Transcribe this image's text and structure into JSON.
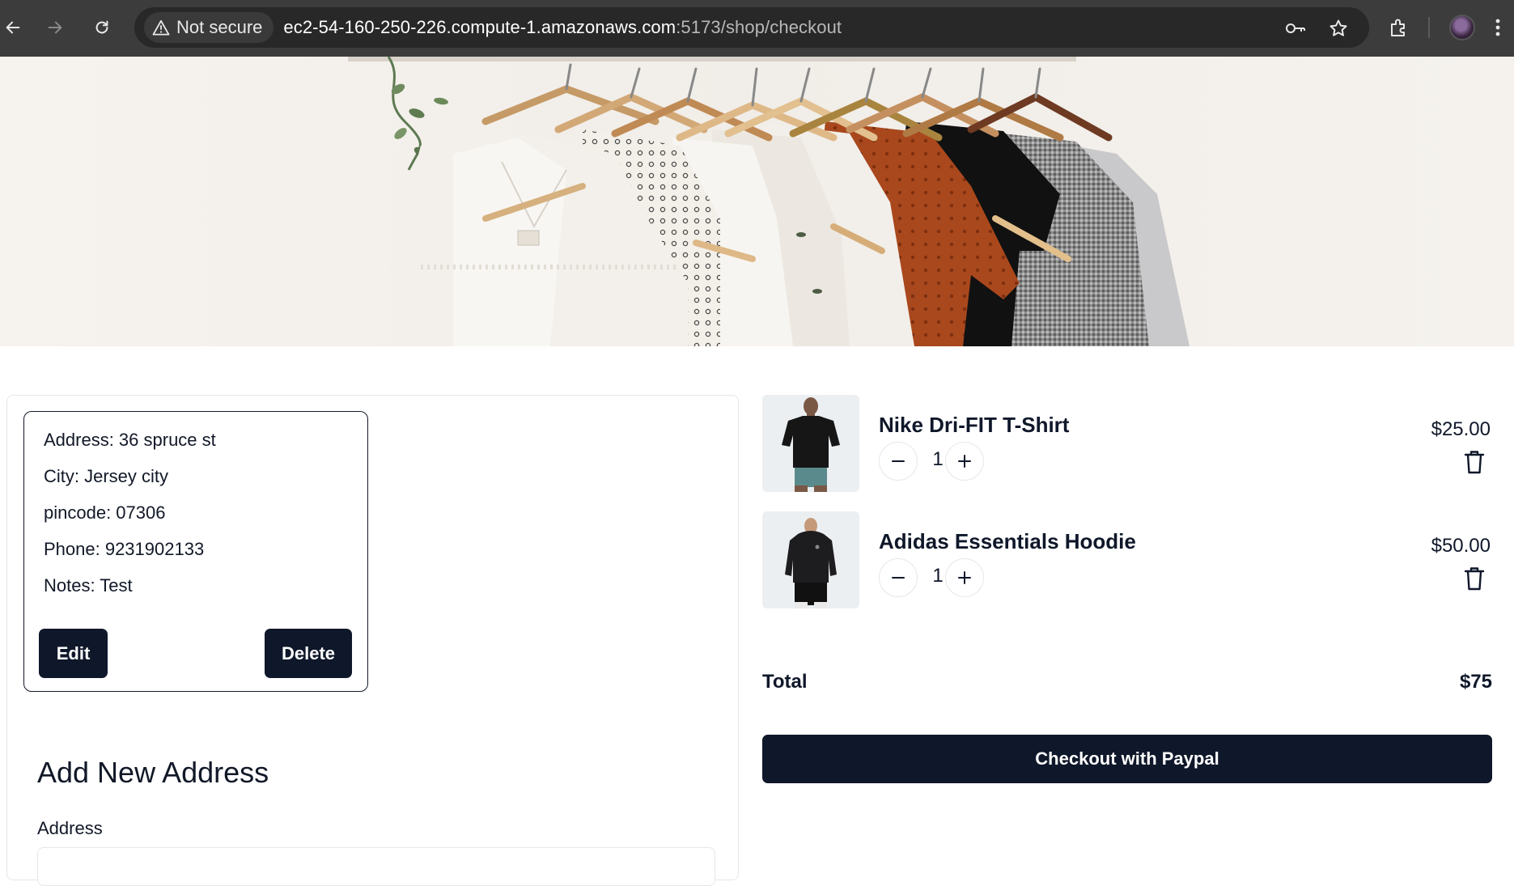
{
  "browser": {
    "security_label": "Not secure",
    "url_host": "ec2-54-160-250-226.compute-1.amazonaws.com",
    "url_path": ":5173/shop/checkout",
    "icons": [
      "back-icon",
      "forward-icon",
      "reload-icon",
      "warning-icon",
      "key-icon",
      "star-icon",
      "extensions-icon",
      "avatar",
      "more-icon"
    ]
  },
  "hero": {
    "image": "clothes-on-hangers-banner"
  },
  "address_card": {
    "address": "Address: 36 spruce st",
    "city": "City: Jersey city",
    "pincode": "pincode: 07306",
    "phone": "Phone: 9231902133",
    "notes": "Notes: Test",
    "edit_label": "Edit",
    "delete_label": "Delete"
  },
  "add_address": {
    "title": "Add New Address",
    "address_label": "Address"
  },
  "cart": {
    "items": [
      {
        "name": "Nike Dri-FIT T-Shirt",
        "quantity": "1",
        "price": "$25.00"
      },
      {
        "name": "Adidas Essentials Hoodie",
        "quantity": "1",
        "price": "$50.00"
      }
    ],
    "total_label": "Total",
    "total_value": "$75",
    "checkout_label": "Checkout with Paypal"
  },
  "colors": {
    "primary": "#0f172a",
    "chrome_bg": "#3c3c3c",
    "border": "#e5e7eb"
  }
}
